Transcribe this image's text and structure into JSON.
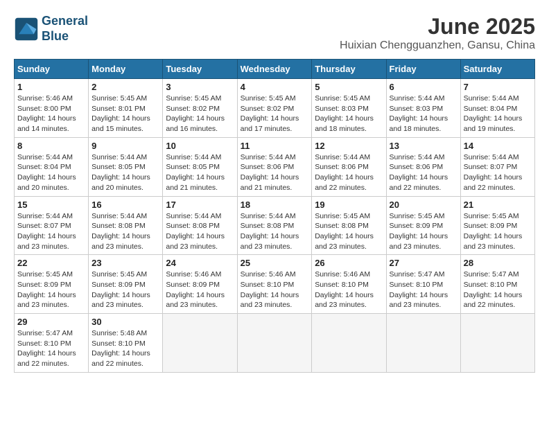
{
  "logo": {
    "line1": "General",
    "line2": "Blue"
  },
  "title": "June 2025",
  "location": "Huixian Chengguanzhen, Gansu, China",
  "headers": [
    "Sunday",
    "Monday",
    "Tuesday",
    "Wednesday",
    "Thursday",
    "Friday",
    "Saturday"
  ],
  "weeks": [
    [
      {
        "day": 1,
        "info": "Sunrise: 5:46 AM\nSunset: 8:00 PM\nDaylight: 14 hours\nand 14 minutes."
      },
      {
        "day": 2,
        "info": "Sunrise: 5:45 AM\nSunset: 8:01 PM\nDaylight: 14 hours\nand 15 minutes."
      },
      {
        "day": 3,
        "info": "Sunrise: 5:45 AM\nSunset: 8:02 PM\nDaylight: 14 hours\nand 16 minutes."
      },
      {
        "day": 4,
        "info": "Sunrise: 5:45 AM\nSunset: 8:02 PM\nDaylight: 14 hours\nand 17 minutes."
      },
      {
        "day": 5,
        "info": "Sunrise: 5:45 AM\nSunset: 8:03 PM\nDaylight: 14 hours\nand 18 minutes."
      },
      {
        "day": 6,
        "info": "Sunrise: 5:44 AM\nSunset: 8:03 PM\nDaylight: 14 hours\nand 18 minutes."
      },
      {
        "day": 7,
        "info": "Sunrise: 5:44 AM\nSunset: 8:04 PM\nDaylight: 14 hours\nand 19 minutes."
      }
    ],
    [
      {
        "day": 8,
        "info": "Sunrise: 5:44 AM\nSunset: 8:04 PM\nDaylight: 14 hours\nand 20 minutes."
      },
      {
        "day": 9,
        "info": "Sunrise: 5:44 AM\nSunset: 8:05 PM\nDaylight: 14 hours\nand 20 minutes."
      },
      {
        "day": 10,
        "info": "Sunrise: 5:44 AM\nSunset: 8:05 PM\nDaylight: 14 hours\nand 21 minutes."
      },
      {
        "day": 11,
        "info": "Sunrise: 5:44 AM\nSunset: 8:06 PM\nDaylight: 14 hours\nand 21 minutes."
      },
      {
        "day": 12,
        "info": "Sunrise: 5:44 AM\nSunset: 8:06 PM\nDaylight: 14 hours\nand 22 minutes."
      },
      {
        "day": 13,
        "info": "Sunrise: 5:44 AM\nSunset: 8:06 PM\nDaylight: 14 hours\nand 22 minutes."
      },
      {
        "day": 14,
        "info": "Sunrise: 5:44 AM\nSunset: 8:07 PM\nDaylight: 14 hours\nand 22 minutes."
      }
    ],
    [
      {
        "day": 15,
        "info": "Sunrise: 5:44 AM\nSunset: 8:07 PM\nDaylight: 14 hours\nand 23 minutes."
      },
      {
        "day": 16,
        "info": "Sunrise: 5:44 AM\nSunset: 8:08 PM\nDaylight: 14 hours\nand 23 minutes."
      },
      {
        "day": 17,
        "info": "Sunrise: 5:44 AM\nSunset: 8:08 PM\nDaylight: 14 hours\nand 23 minutes."
      },
      {
        "day": 18,
        "info": "Sunrise: 5:44 AM\nSunset: 8:08 PM\nDaylight: 14 hours\nand 23 minutes."
      },
      {
        "day": 19,
        "info": "Sunrise: 5:45 AM\nSunset: 8:08 PM\nDaylight: 14 hours\nand 23 minutes."
      },
      {
        "day": 20,
        "info": "Sunrise: 5:45 AM\nSunset: 8:09 PM\nDaylight: 14 hours\nand 23 minutes."
      },
      {
        "day": 21,
        "info": "Sunrise: 5:45 AM\nSunset: 8:09 PM\nDaylight: 14 hours\nand 23 minutes."
      }
    ],
    [
      {
        "day": 22,
        "info": "Sunrise: 5:45 AM\nSunset: 8:09 PM\nDaylight: 14 hours\nand 23 minutes."
      },
      {
        "day": 23,
        "info": "Sunrise: 5:45 AM\nSunset: 8:09 PM\nDaylight: 14 hours\nand 23 minutes."
      },
      {
        "day": 24,
        "info": "Sunrise: 5:46 AM\nSunset: 8:09 PM\nDaylight: 14 hours\nand 23 minutes."
      },
      {
        "day": 25,
        "info": "Sunrise: 5:46 AM\nSunset: 8:10 PM\nDaylight: 14 hours\nand 23 minutes."
      },
      {
        "day": 26,
        "info": "Sunrise: 5:46 AM\nSunset: 8:10 PM\nDaylight: 14 hours\nand 23 minutes."
      },
      {
        "day": 27,
        "info": "Sunrise: 5:47 AM\nSunset: 8:10 PM\nDaylight: 14 hours\nand 23 minutes."
      },
      {
        "day": 28,
        "info": "Sunrise: 5:47 AM\nSunset: 8:10 PM\nDaylight: 14 hours\nand 22 minutes."
      }
    ],
    [
      {
        "day": 29,
        "info": "Sunrise: 5:47 AM\nSunset: 8:10 PM\nDaylight: 14 hours\nand 22 minutes."
      },
      {
        "day": 30,
        "info": "Sunrise: 5:48 AM\nSunset: 8:10 PM\nDaylight: 14 hours\nand 22 minutes."
      },
      {
        "day": null,
        "info": ""
      },
      {
        "day": null,
        "info": ""
      },
      {
        "day": null,
        "info": ""
      },
      {
        "day": null,
        "info": ""
      },
      {
        "day": null,
        "info": ""
      }
    ]
  ]
}
